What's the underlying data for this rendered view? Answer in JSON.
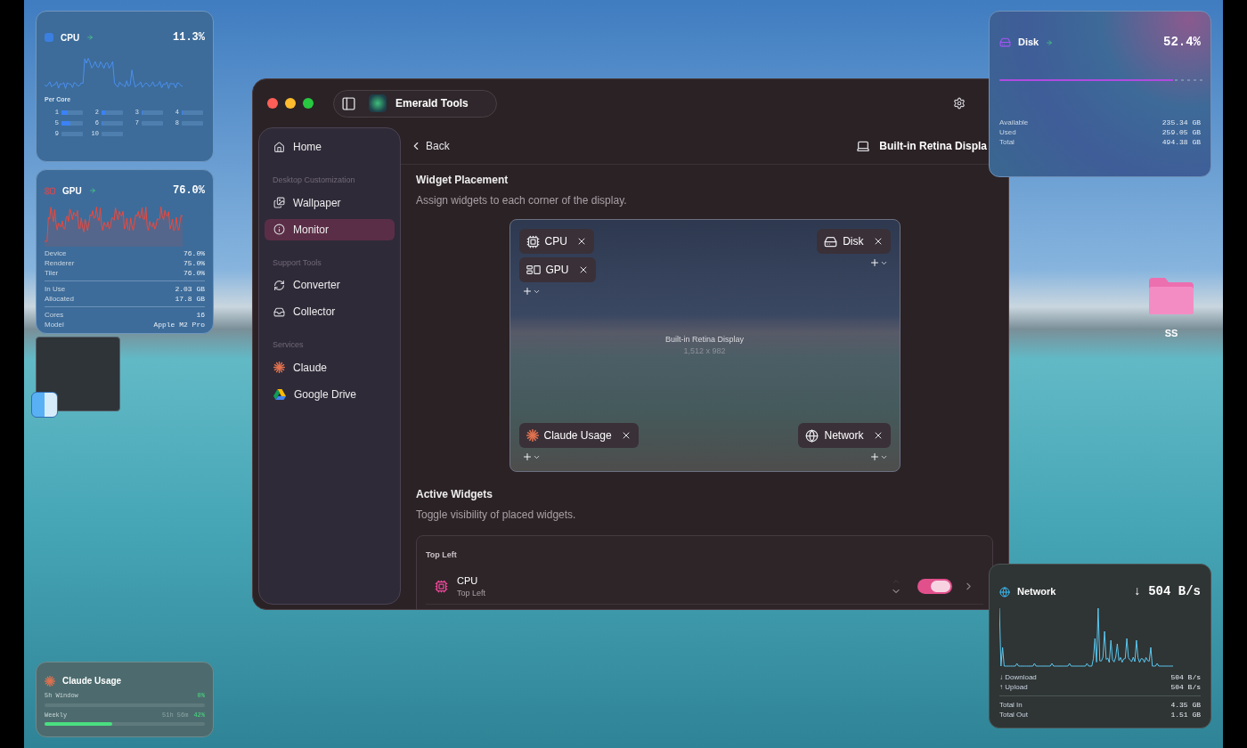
{
  "desktop": {
    "folder": {
      "label": "SS"
    }
  },
  "widgets": {
    "cpu": {
      "title": "CPU",
      "value": "11.3%",
      "per_core_label": "Per Core",
      "cores": [
        {
          "label": "1",
          "level": 0.3
        },
        {
          "label": "2",
          "level": 0.15
        },
        {
          "label": "3",
          "level": 0.05
        },
        {
          "label": "4",
          "level": 0.04
        },
        {
          "label": "5",
          "level": 0.4
        },
        {
          "label": "6",
          "level": 0.05
        },
        {
          "label": "7",
          "level": 0.0
        },
        {
          "label": "8",
          "level": 0.0
        },
        {
          "label": "9",
          "level": 0.0
        },
        {
          "label": "10",
          "level": 0.0
        }
      ]
    },
    "gpu": {
      "title": "GPU",
      "value": "76.0%",
      "groups": [
        [
          {
            "label": "Device",
            "value": "76.0%"
          },
          {
            "label": "Renderer",
            "value": "75.0%"
          },
          {
            "label": "Tiler",
            "value": "76.0%"
          }
        ],
        [
          {
            "label": "In Use",
            "value": "2.03 GB"
          },
          {
            "label": "Allocated",
            "value": "17.8 GB"
          }
        ],
        [
          {
            "label": "Cores",
            "value": "16"
          },
          {
            "label": "Model",
            "value": "Apple M2 Pro"
          }
        ]
      ]
    },
    "disk": {
      "title": "Disk",
      "value": "52.4%",
      "rows": [
        {
          "label": "Available",
          "value": "235.34 GB"
        },
        {
          "label": "Used",
          "value": "259.05 GB"
        },
        {
          "label": "Total",
          "value": "494.38 GB"
        }
      ]
    },
    "network": {
      "title": "Network",
      "value": "↓ 504 B/s",
      "groups": [
        [
          {
            "label": "↓ Download",
            "value": "504 B/s"
          },
          {
            "label": "↑ Upload",
            "value": "504 B/s"
          }
        ],
        [
          {
            "label": "Total In",
            "value": "4.35 GB"
          },
          {
            "label": "Total Out",
            "value": "1.51 GB"
          }
        ]
      ]
    },
    "claude": {
      "title": "Claude Usage",
      "rows": [
        {
          "label": "5h Window",
          "value": "0%",
          "level": 0.0
        },
        {
          "label": "Weekly",
          "time": "51h 56m",
          "value": "42%",
          "level": 0.42
        }
      ]
    }
  },
  "app": {
    "title": "Emerald Tools",
    "sidebar": [
      {
        "kind": "item",
        "label": "Home",
        "selected": false
      },
      {
        "kind": "section",
        "label": "Desktop Customization"
      },
      {
        "kind": "item",
        "label": "Wallpaper",
        "selected": false
      },
      {
        "kind": "item",
        "label": "Monitor",
        "selected": true
      },
      {
        "kind": "section",
        "label": "Support Tools"
      },
      {
        "kind": "item",
        "label": "Converter",
        "selected": false
      },
      {
        "kind": "item",
        "label": "Collector",
        "selected": false
      },
      {
        "kind": "section",
        "label": "Services"
      },
      {
        "kind": "item",
        "label": "Claude",
        "selected": false
      },
      {
        "kind": "item",
        "label": "Google Drive",
        "selected": false
      }
    ],
    "back": "Back",
    "display": "Built-in Retina Displa",
    "placement": {
      "title": "Widget Placement",
      "subtitle": "Assign widgets to each corner of the display.",
      "preview_label": "Built-in Retina Display",
      "preview_size": "1,512 x 982",
      "corners": [
        {
          "widgets": [
            {
              "kind": "cpu",
              "label": "CPU"
            },
            {
              "kind": "gpu",
              "label": "GPU"
            }
          ]
        },
        {
          "widgets": [
            {
              "kind": "disk",
              "label": "Disk"
            }
          ]
        },
        {
          "widgets": [
            {
              "kind": "claude",
              "label": "Claude Usage"
            }
          ]
        },
        {
          "widgets": [
            {
              "kind": "network",
              "label": "Network"
            }
          ]
        }
      ]
    },
    "active": {
      "title": "Active Widgets",
      "subtitle": "Toggle visibility of placed widgets.",
      "groups": [
        {
          "label": "Top Left",
          "items": [
            {
              "kind": "cpu",
              "name": "CPU",
              "position": "Top Left",
              "on": true
            }
          ]
        }
      ]
    }
  }
}
